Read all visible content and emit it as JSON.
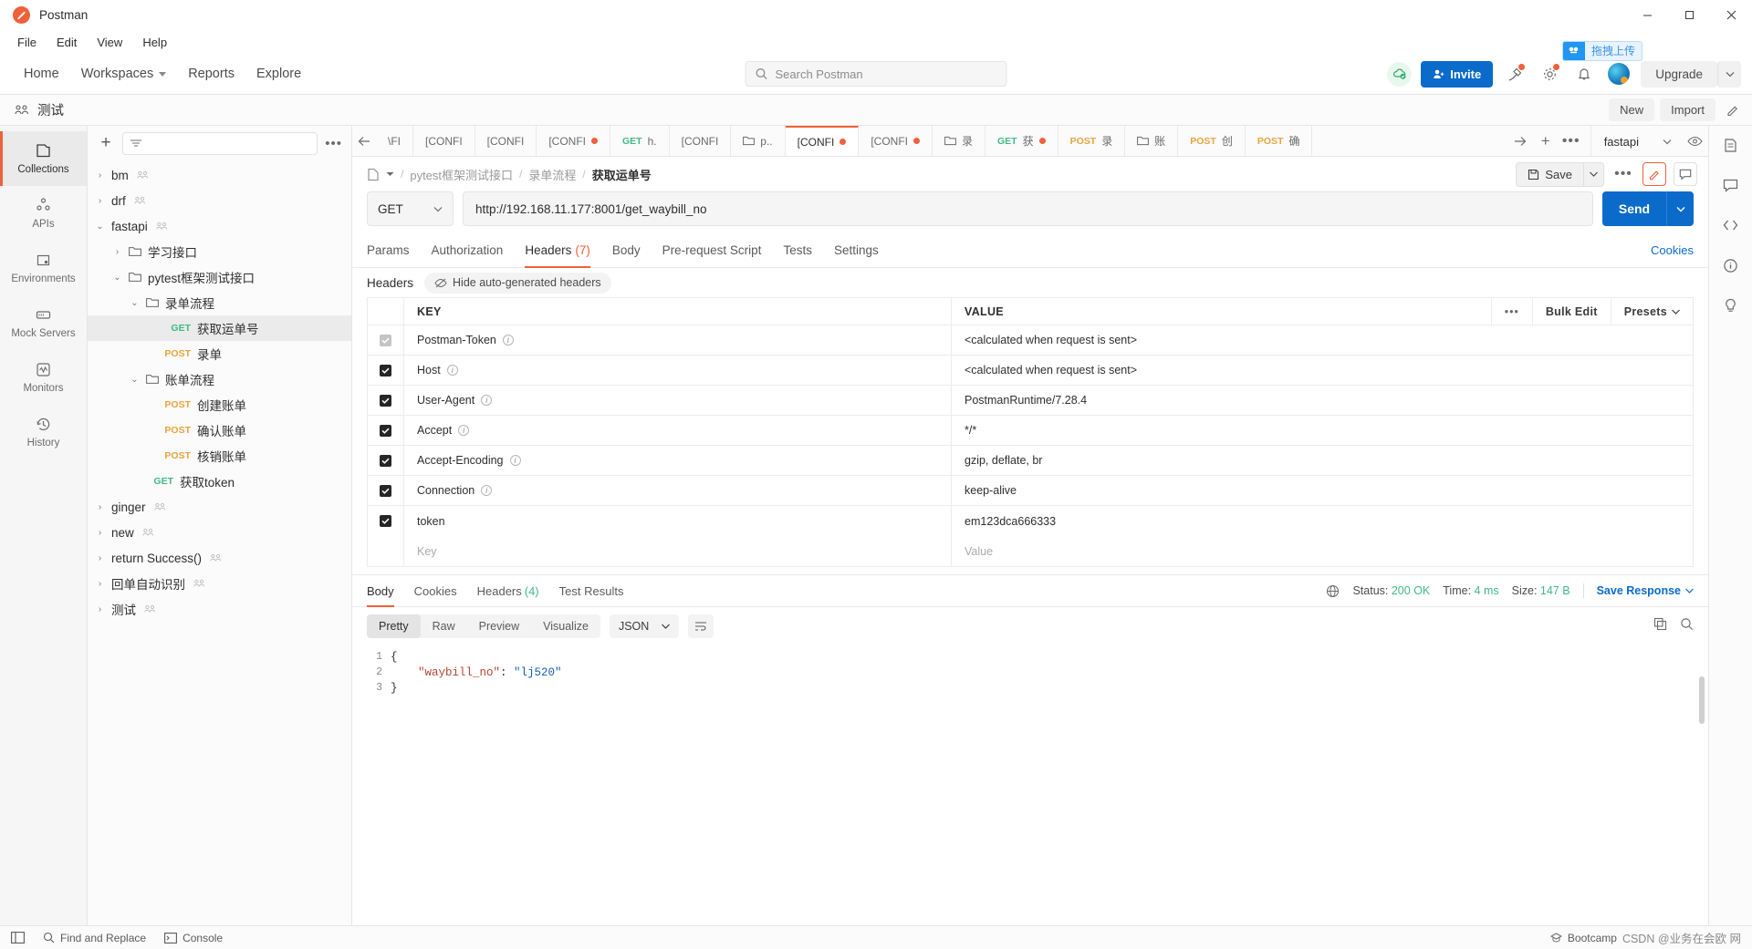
{
  "window": {
    "title": "Postman",
    "minimize": "minimize-icon",
    "maximize": "maximize-icon",
    "close": "close-icon"
  },
  "menubar": [
    "File",
    "Edit",
    "View",
    "Help"
  ],
  "topnav": {
    "links": [
      "Home",
      "Workspaces",
      "Reports",
      "Explore"
    ],
    "search_placeholder": "Search Postman",
    "invite": "Invite",
    "upgrade": "Upgrade",
    "baidu_pill": "拖拽上传"
  },
  "workspace": {
    "name": "测试",
    "new": "New",
    "import": "Import"
  },
  "rail": [
    {
      "label": "Collections",
      "icon": "collections-icon",
      "active": true
    },
    {
      "label": "APIs",
      "icon": "apis-icon",
      "active": false
    },
    {
      "label": "Environments",
      "icon": "environments-icon",
      "active": false
    },
    {
      "label": "Mock Servers",
      "icon": "mock-servers-icon",
      "active": false
    },
    {
      "label": "Monitors",
      "icon": "monitors-icon",
      "active": false
    },
    {
      "label": "History",
      "icon": "history-icon",
      "active": false
    }
  ],
  "tree": [
    {
      "label": "bm",
      "type": "collection",
      "chev": "right",
      "indent": 0,
      "team": true
    },
    {
      "label": "drf",
      "type": "collection",
      "chev": "right",
      "indent": 0,
      "team": true
    },
    {
      "label": "fastapi",
      "type": "collection",
      "chev": "down",
      "indent": 0,
      "team": true
    },
    {
      "label": "学习接口",
      "type": "folder",
      "chev": "right",
      "indent": 1
    },
    {
      "label": "pytest框架测试接口",
      "type": "folder",
      "chev": "down",
      "indent": 1
    },
    {
      "label": "录单流程",
      "type": "folder",
      "chev": "down",
      "indent": 2
    },
    {
      "label": "获取运单号",
      "type": "request",
      "method": "GET",
      "indent": 3,
      "selected": true
    },
    {
      "label": "录单",
      "type": "request",
      "method": "POST",
      "indent": 3
    },
    {
      "label": "账单流程",
      "type": "folder",
      "chev": "down",
      "indent": 2
    },
    {
      "label": "创建账单",
      "type": "request",
      "method": "POST",
      "indent": 3
    },
    {
      "label": "确认账单",
      "type": "request",
      "method": "POST",
      "indent": 3
    },
    {
      "label": "核销账单",
      "type": "request",
      "method": "POST",
      "indent": 3
    },
    {
      "label": "获取token",
      "type": "request",
      "method": "GET",
      "indent": 2
    },
    {
      "label": "ginger",
      "type": "collection",
      "chev": "right",
      "indent": 0,
      "team": true
    },
    {
      "label": "new",
      "type": "collection",
      "chev": "right",
      "indent": 0,
      "team": true
    },
    {
      "label": "return Success()",
      "type": "collection",
      "chev": "right",
      "indent": 0,
      "team": true
    },
    {
      "label": "回单自动识别",
      "type": "collection",
      "chev": "right",
      "indent": 0,
      "team": true
    },
    {
      "label": "测试",
      "type": "collection",
      "chev": "right",
      "indent": 0,
      "team": true
    }
  ],
  "tabstrip": {
    "tabs": [
      {
        "label": "\\FI",
        "kind": "text"
      },
      {
        "label": "[CONFI",
        "kind": "text"
      },
      {
        "label": "[CONFI",
        "kind": "text"
      },
      {
        "label": "[CONFI",
        "kind": "text",
        "dirty": true
      },
      {
        "label": "h.",
        "kind": "method",
        "method": "GET"
      },
      {
        "label": "[CONFI",
        "kind": "text"
      },
      {
        "label": "p..",
        "kind": "folder"
      },
      {
        "label": "[CONFI",
        "kind": "text",
        "dirty": true,
        "active": true
      },
      {
        "label": "[CONFI",
        "kind": "text",
        "dirty": true
      },
      {
        "label": "录",
        "kind": "folder"
      },
      {
        "label": "获",
        "kind": "method",
        "method": "GET",
        "dirty": true
      },
      {
        "label": "录",
        "kind": "method",
        "method": "POST"
      },
      {
        "label": "账",
        "kind": "folder"
      },
      {
        "label": "创",
        "kind": "method",
        "method": "POST"
      },
      {
        "label": "确",
        "kind": "method",
        "method": "POST"
      }
    ],
    "env_name": "fastapi"
  },
  "breadcrumb": {
    "items": [
      "pytest框架测试接口",
      "录单流程",
      "获取运单号"
    ],
    "save_label": "Save"
  },
  "request": {
    "method": "GET",
    "url": "http://192.168.11.177:8001/get_waybill_no",
    "send_label": "Send",
    "tabs": [
      {
        "label": "Params"
      },
      {
        "label": "Authorization"
      },
      {
        "label": "Headers",
        "count": "(7)",
        "active": true
      },
      {
        "label": "Body"
      },
      {
        "label": "Pre-request Script"
      },
      {
        "label": "Tests"
      },
      {
        "label": "Settings"
      }
    ],
    "cookies_link": "Cookies",
    "headers_label": "Headers",
    "hide_auto": "Hide auto-generated headers",
    "table": {
      "columns": [
        "KEY",
        "VALUE"
      ],
      "bulk_edit": "Bulk Edit",
      "presets": "Presets",
      "rows": [
        {
          "checked": true,
          "dim": true,
          "key": "Postman-Token",
          "info": true,
          "value": "<calculated when request is sent>"
        },
        {
          "checked": true,
          "key": "Host",
          "info": true,
          "value": "<calculated when request is sent>"
        },
        {
          "checked": true,
          "key": "User-Agent",
          "info": true,
          "value": "PostmanRuntime/7.28.4"
        },
        {
          "checked": true,
          "key": "Accept",
          "info": true,
          "value": "*/*"
        },
        {
          "checked": true,
          "key": "Accept-Encoding",
          "info": true,
          "value": "gzip, deflate, br"
        },
        {
          "checked": true,
          "key": "Connection",
          "info": true,
          "value": "keep-alive"
        },
        {
          "checked": true,
          "key": "token",
          "info": false,
          "value": "em123dca666333"
        }
      ],
      "empty_key_placeholder": "Key",
      "empty_value_placeholder": "Value"
    }
  },
  "response": {
    "tabs": [
      {
        "label": "Body",
        "active": true
      },
      {
        "label": "Cookies"
      },
      {
        "label": "Headers",
        "count": "(4)"
      },
      {
        "label": "Test Results"
      }
    ],
    "status_label": "Status:",
    "status_value": "200 OK",
    "time_label": "Time:",
    "time_value": "4 ms",
    "size_label": "Size:",
    "size_value": "147 B",
    "save_response": "Save Response",
    "view_modes": [
      "Pretty",
      "Raw",
      "Preview",
      "Visualize"
    ],
    "active_view": "Pretty",
    "format": "JSON",
    "body_lines": [
      {
        "n": "1",
        "segments": [
          {
            "t": "{",
            "c": "jb"
          }
        ]
      },
      {
        "n": "2",
        "segments": [
          {
            "t": "    ",
            "c": "jp"
          },
          {
            "t": "\"waybill_no\"",
            "c": "jk"
          },
          {
            "t": ": ",
            "c": "jp"
          },
          {
            "t": "\"lj520\"",
            "c": "jv"
          }
        ]
      },
      {
        "n": "3",
        "segments": [
          {
            "t": "}",
            "c": "jb"
          }
        ]
      }
    ]
  },
  "statusbar": {
    "find_replace": "Find and Replace",
    "console": "Console",
    "bootcamp": "Bootcamp",
    "watermark": "CSDN @业务在会欧 网"
  },
  "colors": {
    "accent": "#f0603a",
    "blue": "#0b6bcb",
    "green": "#42b983",
    "orange": "#e8a33d"
  }
}
